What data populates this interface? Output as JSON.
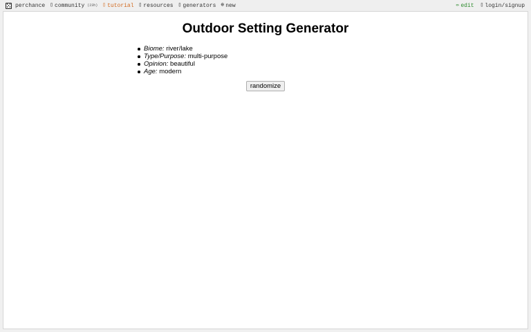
{
  "topbar": {
    "brand": "perchance",
    "community": "community",
    "community_count": "(23h)",
    "tutorial": "tutorial",
    "resources": "resources",
    "generators": "generators",
    "new": "new",
    "edit": "edit",
    "login": "login/signup",
    "icons": {
      "brand": "dice-icon",
      "community": "chat-icon",
      "tutorial": "book-icon",
      "resources": "books-icon",
      "generators": "grid-icon",
      "new": "plus-circle-icon",
      "edit": "pencil-icon",
      "login": "user-icon"
    },
    "colors": {
      "tutorial": "#d2691e",
      "edit": "#2e8b2e"
    }
  },
  "page": {
    "title": "Outdoor Setting Generator",
    "properties": [
      {
        "key": "Biome:",
        "value": "river/lake"
      },
      {
        "key": "Type/Purpose:",
        "value": "multi-purpose"
      },
      {
        "key": "Opinion:",
        "value": "beautiful"
      },
      {
        "key": "Age:",
        "value": "modern"
      }
    ],
    "randomize_label": "randomize"
  }
}
